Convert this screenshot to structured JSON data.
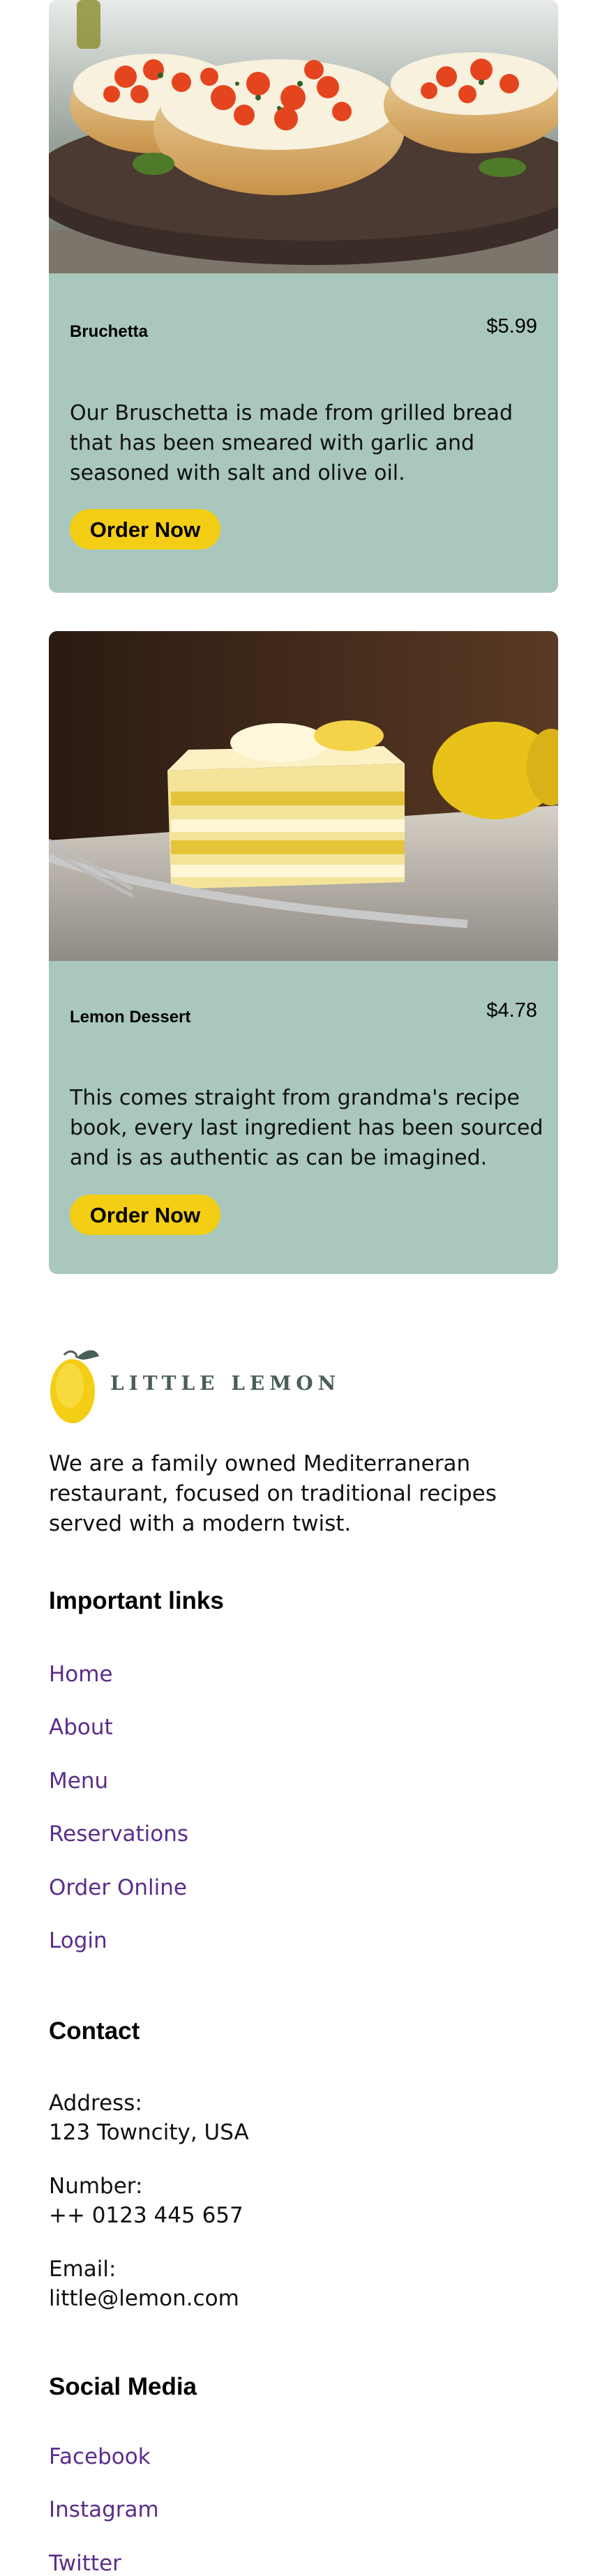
{
  "menu_items": [
    {
      "name": "Bruchetta",
      "price": "$5.99",
      "description": "Our Bruschetta is made from grilled bread that has been smeared with garlic and seasoned with salt and olive oil.",
      "button_label": "Order Now"
    },
    {
      "name": "Lemon Dessert",
      "price": "$4.78",
      "description": "This comes straight from grandma's recipe book, every last ingredient has been sourced and is as authentic as can be imagined.",
      "button_label": "Order Now"
    }
  ],
  "footer": {
    "logo_text": "LITTLE LEMON",
    "about": "We are a family owned Mediterraneran restaurant, focused on traditional recipes served with a modern twist.",
    "important_links": {
      "heading": "Important links",
      "items": [
        "Home",
        "About",
        "Menu",
        "Reservations",
        "Order Online",
        "Login"
      ]
    },
    "contact": {
      "heading": "Contact",
      "address_label": "Address:",
      "address": "123 Towncity, USA",
      "number_label": "Number:",
      "number": "++ 0123 445 657",
      "email_label": "Email:",
      "email": "little@lemon.com"
    },
    "social": {
      "heading": "Social Media",
      "items": [
        "Facebook",
        "Instagram",
        "Twitter"
      ]
    }
  },
  "colors": {
    "card_background": "#a9c7bc",
    "button_yellow": "#f4ce14",
    "link_purple": "#5b2d8a",
    "brand_green": "#495e57"
  }
}
